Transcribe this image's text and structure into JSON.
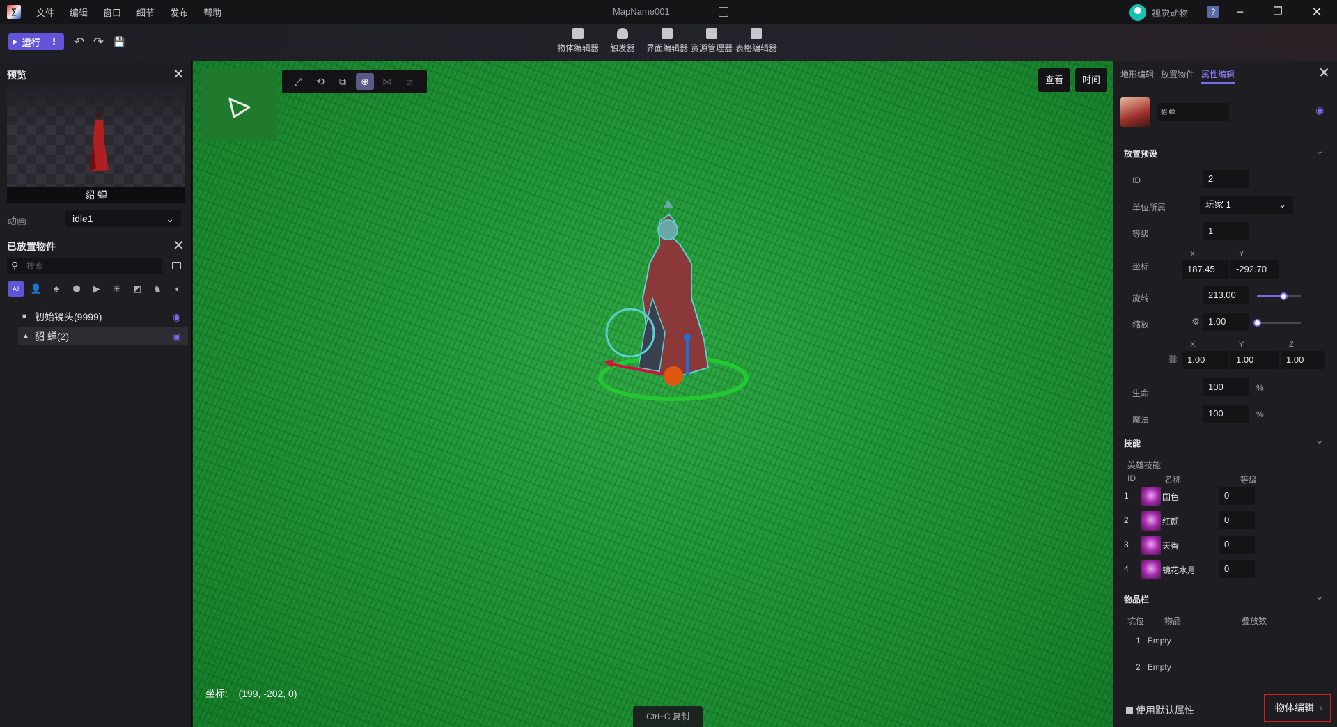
{
  "titlebar": {
    "logo_glyph": "∑",
    "menu": [
      "文件",
      "编辑",
      "窗口",
      "细节",
      "发布",
      "帮助"
    ],
    "map_name": "MapName001",
    "username": "视觉动物",
    "help_glyph": "?",
    "min": "−",
    "restore": "❐",
    "close": "✕"
  },
  "toolbar": {
    "run_label": "运行",
    "run_play": "▶",
    "run_more": "⋮",
    "undo": "↶",
    "redo": "↷",
    "save": "💾",
    "editors": [
      "物体编辑器",
      "触发器",
      "界面编辑器",
      "资源管理器",
      "表格编辑器"
    ]
  },
  "preview": {
    "title": "预览",
    "close": "✕",
    "unit_name": "貂 蝉",
    "anim_label": "动画",
    "anim_value": "idle1",
    "chevron": "⌄"
  },
  "placed": {
    "title": "已放置物件",
    "close": "✕",
    "search_icon": "⚲",
    "search_placeholder": "搜索",
    "filters": [
      "All",
      "👤",
      "♣",
      "⬢",
      "▶",
      "✳",
      "◩",
      "♞",
      "◐"
    ],
    "items": [
      {
        "icon": "■",
        "label": "初始镜头(9999)",
        "eye": "◉"
      },
      {
        "icon": "▲",
        "label": "貂 蝉(2)",
        "eye": "◉"
      }
    ]
  },
  "viewport": {
    "tools": [
      "⤢",
      "⟲",
      "⧉",
      "⊕",
      "⋈",
      "⧄"
    ],
    "view_btn": "查看",
    "time_btn": "时间",
    "coords_label": "坐标:",
    "coords_value": "(199, -202, 0)",
    "copy_hint": "Ctrl+C 复制"
  },
  "right": {
    "tabs": [
      "地形编辑",
      "放置物件",
      "属性编辑"
    ],
    "active_tab": 2,
    "close": "✕",
    "unit_name": "貂 蝉",
    "eye": "◉",
    "placement": {
      "title": "放置预设",
      "chev": "⌄",
      "id_label": "ID",
      "id_value": "2",
      "owner_label": "单位所属",
      "owner_value": "玩家 1",
      "level_label": "等级",
      "level_value": "1",
      "coord_label": "坐标",
      "x_label": "X",
      "y_label": "Y",
      "x_value": "187.45",
      "y_value": "-292.70",
      "rotate_label": "旋转",
      "rotate_value": "213.00",
      "rotate_fraction": 0.59,
      "scale_label": "缩放",
      "scale_value": "1.00",
      "scale_fraction": 0.0,
      "gear": "⚙",
      "sx_label": "X",
      "sy_label": "Y",
      "sz_label": "Z",
      "link": "⛓",
      "sx_value": "1.00",
      "sy_value": "1.00",
      "sz_value": "1.00",
      "life_label": "生命",
      "life_value": "100",
      "pct": "%",
      "mana_label": "魔法",
      "mana_value": "100"
    },
    "skills": {
      "title": "技能",
      "chev": "⌄",
      "subtitle": "英雄技能",
      "col_id": "ID",
      "col_name": "名称",
      "col_level": "等级",
      "rows": [
        {
          "id": "1",
          "name": "国色",
          "level": "0"
        },
        {
          "id": "2",
          "name": "红颜",
          "level": "0"
        },
        {
          "id": "3",
          "name": "天香",
          "level": "0"
        },
        {
          "id": "4",
          "name": "镜花水月",
          "level": "0"
        }
      ]
    },
    "inventory": {
      "title": "物品栏",
      "chev": "⌄",
      "col_slot": "坑位",
      "col_item": "物品",
      "col_stack": "叠放数",
      "rows": [
        {
          "slot": "1",
          "item": "Empty"
        },
        {
          "slot": "2",
          "item": "Empty"
        }
      ]
    },
    "default_attr_label": "使用默认属性",
    "object_edit_label": "物体编辑",
    "object_edit_arrow": "›"
  },
  "colors": {
    "accent": "#7a6cf0",
    "run": "#6254d8",
    "grass": "#219638",
    "highlight_border": "#d42020"
  }
}
